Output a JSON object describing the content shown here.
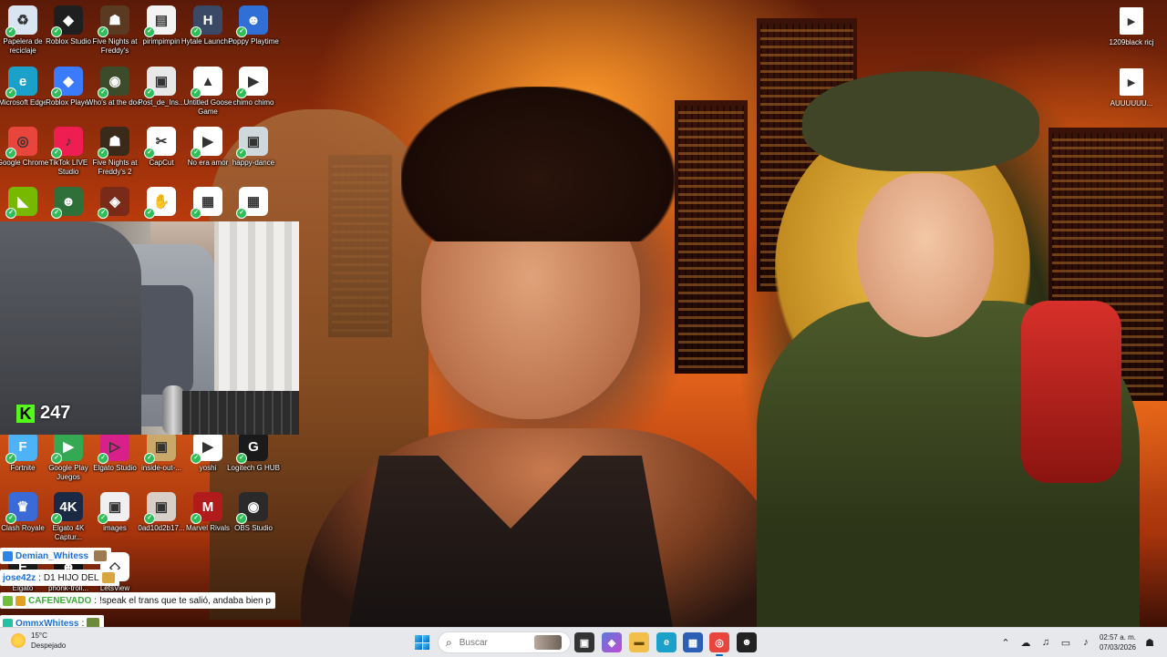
{
  "desktop_icons": [
    {
      "name": "recycle-bin",
      "label": "Papelera de reciclaje",
      "glyph": "♻",
      "color": "#d9e6f2"
    },
    {
      "name": "roblox-studio",
      "label": "Roblox Studio",
      "glyph": "◆",
      "color": "#1f1f1f"
    },
    {
      "name": "fnaf",
      "label": "Five Nights at Freddy's",
      "glyph": "☗",
      "color": "#5b3a22"
    },
    {
      "name": "pirimpimpin",
      "label": "pirimpimpin",
      "glyph": "▤",
      "color": "#f3f3f3"
    },
    {
      "name": "hytale-launcher",
      "label": "Hytale Launcher",
      "glyph": "H",
      "color": "#3a4a66"
    },
    {
      "name": "poppy-playtime",
      "label": "Poppy Playtime",
      "glyph": "☻",
      "color": "#2f6fd6"
    },
    {
      "name": "microsoft-edge",
      "label": "Microsoft Edge",
      "glyph": "e",
      "color": "#1aa0c9"
    },
    {
      "name": "roblox-player",
      "label": "Roblox Player",
      "glyph": "◆",
      "color": "#3b7bff"
    },
    {
      "name": "whos-at-the-door",
      "label": "Who's at the door",
      "glyph": "◉",
      "color": "#3c4c2a"
    },
    {
      "name": "post-de-ins",
      "label": "Post_de_Ins...",
      "glyph": "▣",
      "color": "#e8e8e8"
    },
    {
      "name": "untitled-goose-game",
      "label": "Untitled Goose Game",
      "glyph": "▲",
      "color": "#ffffff"
    },
    {
      "name": "chimo-chimo",
      "label": "chimo chimo",
      "glyph": "▶",
      "color": "#ffffff"
    },
    {
      "name": "google-chrome",
      "label": "Google Chrome",
      "glyph": "◎",
      "color": "#e8453c"
    },
    {
      "name": "tiktok-live-studio",
      "label": "TikTok LIVE Studio",
      "glyph": "♪",
      "color": "#ee1d52"
    },
    {
      "name": "fnaf-2",
      "label": "Five Nights at Freddy's 2",
      "glyph": "☗",
      "color": "#3a2a1a"
    },
    {
      "name": "capcut",
      "label": "CapCut",
      "glyph": "✂",
      "color": "#ffffff"
    },
    {
      "name": "no-era-amor",
      "label": "No era amor",
      "glyph": "▶",
      "color": "#ffffff"
    },
    {
      "name": "happy-dance",
      "label": "happy-dance",
      "glyph": "▣",
      "color": "#cfd8dc"
    },
    {
      "name": "nvidia",
      "label": "",
      "glyph": "◣",
      "color": "#76b900"
    },
    {
      "name": "app-green",
      "label": "",
      "glyph": "☻",
      "color": "#2f6f3a"
    },
    {
      "name": "app-game",
      "label": "",
      "glyph": "◈",
      "color": "#7a2a18"
    },
    {
      "name": "app-paw",
      "label": "",
      "glyph": "✋",
      "color": "#ffffff"
    },
    {
      "name": "app-img-1",
      "label": "",
      "glyph": "▦",
      "color": "#ffffff"
    },
    {
      "name": "app-img-2",
      "label": "",
      "glyph": "▦",
      "color": "#ffffff"
    },
    {
      "name": "fortnite",
      "label": "Fortnite",
      "glyph": "F",
      "color": "#4db3f6"
    },
    {
      "name": "google-play-juegos",
      "label": "Google Play Juegos",
      "glyph": "▶",
      "color": "#34a853"
    },
    {
      "name": "elgato-studio",
      "label": "Elgato Studio",
      "glyph": "▷",
      "color": "#d8208a"
    },
    {
      "name": "inside-out",
      "label": "inside-out-...",
      "glyph": "▣",
      "color": "#c9a86a"
    },
    {
      "name": "yoshi",
      "label": "yoshi",
      "glyph": "▶",
      "color": "#ffffff"
    },
    {
      "name": "logitech-g-hub",
      "label": "Logitech G HUB",
      "glyph": "G",
      "color": "#1a1a1a"
    },
    {
      "name": "clash-royale",
      "label": "Clash Royale",
      "glyph": "♛",
      "color": "#3a6ad6"
    },
    {
      "name": "elgato-4k-captur",
      "label": "Elgato 4K Captur...",
      "glyph": "4K",
      "color": "#1a2a44"
    },
    {
      "name": "images",
      "label": "images",
      "glyph": "▣",
      "color": "#f0f0f0"
    },
    {
      "name": "0ad10d2b17",
      "label": "0ad10d2b17...",
      "glyph": "▣",
      "color": "#d8d0c8"
    },
    {
      "name": "marvel-rivals",
      "label": "Marvel Rivals",
      "glyph": "M",
      "color": "#b11b1b"
    },
    {
      "name": "obs-studio",
      "label": "OBS Studio",
      "glyph": "◉",
      "color": "#2a2a2a"
    },
    {
      "name": "elgato",
      "label": "Elgato",
      "glyph": "E",
      "color": "#1a1a1a"
    },
    {
      "name": "phonk-troll",
      "label": "phonk-troll...",
      "glyph": "☻",
      "color": "#111111"
    },
    {
      "name": "letsview",
      "label": "LetsView",
      "glyph": "◇",
      "color": "#ffffff"
    }
  ],
  "top_right_icons": [
    {
      "label": "1209black ricj"
    },
    {
      "label": "AUUUUUU..."
    }
  ],
  "webcam": {
    "kick_logo": "K",
    "viewer_count": "247"
  },
  "chat": [
    {
      "user": "Demian_Whitess",
      "sep": "",
      "message": "",
      "user_color": "#1c6fd6"
    },
    {
      "user": "jose42z",
      "sep": ":",
      "message": "D1 HIJO DEL",
      "user_color": "#1c6fd6"
    },
    {
      "user": "CAFENEVADO",
      "sep": ":",
      "message": "!speak el trans que te salió, andaba bien p",
      "user_color": "#3fa83a"
    },
    {
      "user": "OmmxWhitess",
      "sep": ":",
      "message": "",
      "user_color": "#1c6fd6"
    }
  ],
  "taskbar": {
    "weather_temp": "15°C",
    "weather_desc": "Despejado",
    "search_placeholder": "Buscar",
    "time": "02:57 a. m.",
    "date": "07/03/2026"
  },
  "colors": {
    "kick_green": "#53fc18",
    "taskbar_bg": "#e6e8ec",
    "accent": "#0067c0"
  }
}
